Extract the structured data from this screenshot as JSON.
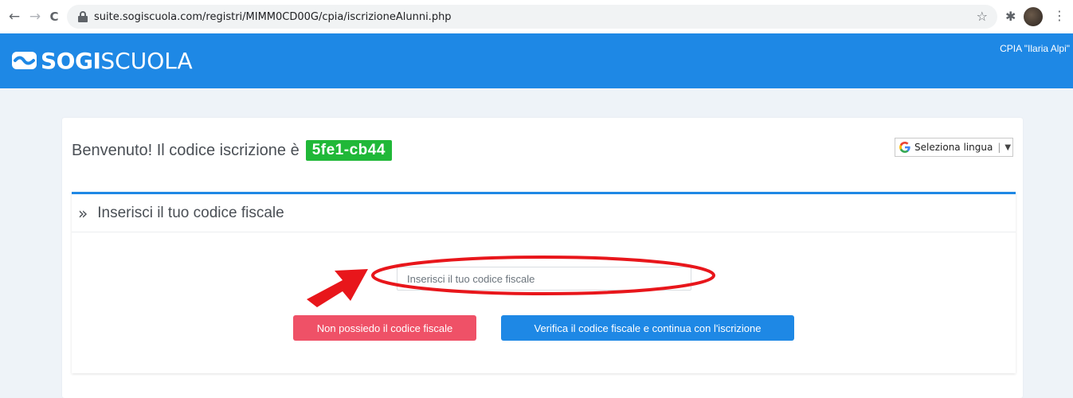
{
  "browser": {
    "url": "suite.sogiscuola.com/registri/MIMM0CD00G/cpia/iscrizioneAlunni.php",
    "back_icon": "←",
    "forward_icon": "→",
    "reload_icon": "C",
    "star_icon": "☆",
    "extensions_icon": "✱",
    "menu_icon": "⋮"
  },
  "header": {
    "logo_bold": "SOGI",
    "logo_light": "SCUOLA",
    "school_name": "CPIA \"Ilaria Alpi\""
  },
  "welcome": {
    "text": "Benvenuto! Il codice iscrizione è",
    "code": "5fe1-cb44"
  },
  "language": {
    "google_glyph": "G",
    "label": "Seleziona lingua",
    "separator": "|",
    "arrow": "▼"
  },
  "panel": {
    "chevron": "»",
    "title": "Inserisci il tuo codice fiscale",
    "input_placeholder": "Inserisci il tuo codice fiscale",
    "no_cf_button": "Non possiedo il codice fiscale",
    "verify_button": "Verifica il codice fiscale e continua con l'iscrizione"
  },
  "colors": {
    "header_blue": "#1e88e5",
    "badge_green": "#20b838",
    "button_red": "#ef5167",
    "annotation_red": "#e8161b"
  }
}
